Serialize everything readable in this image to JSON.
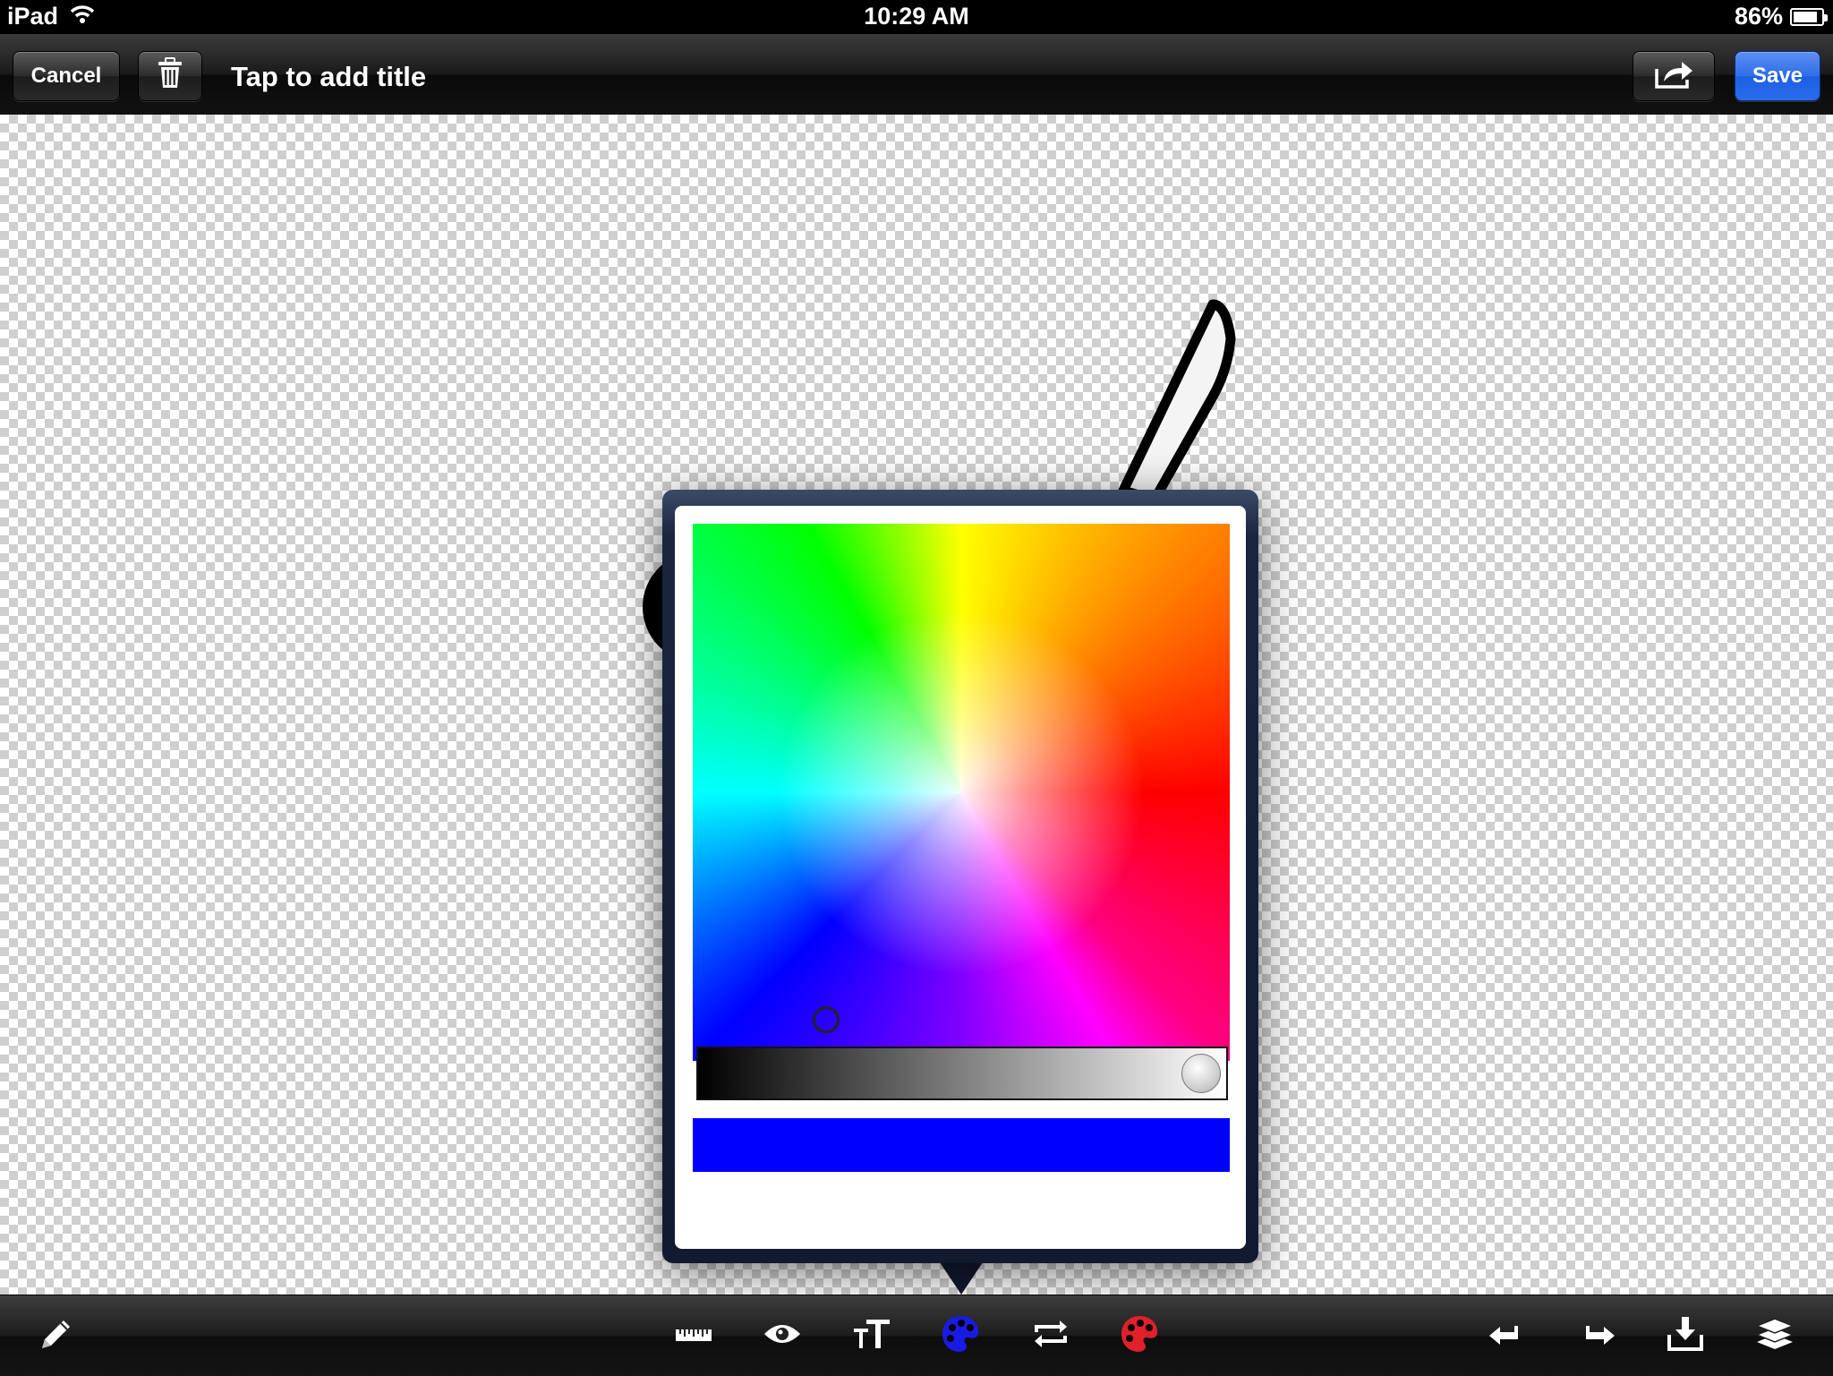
{
  "status_bar": {
    "device": "iPad",
    "time": "10:29 AM",
    "battery": "86%",
    "battery_level": 0.86
  },
  "top_toolbar": {
    "cancel_label": "Cancel",
    "title": "Tap to add title",
    "save_label": "Save",
    "trash_icon": "trash-icon",
    "share_icon": "share-icon"
  },
  "color_picker": {
    "selected_color": "#0000ff",
    "brightness": 0.95
  },
  "bottom_toolbar": {
    "tools": [
      "pencil-icon",
      "ruler-icon",
      "eye-icon",
      "text-size-icon",
      "palette-icon",
      "crop-rotate-icon",
      "palette-red-icon",
      "undo-icon",
      "redo-icon",
      "download-icon",
      "layers-icon"
    ],
    "accent_blue": "#1a1ae6",
    "accent_red": "#e0202a"
  }
}
